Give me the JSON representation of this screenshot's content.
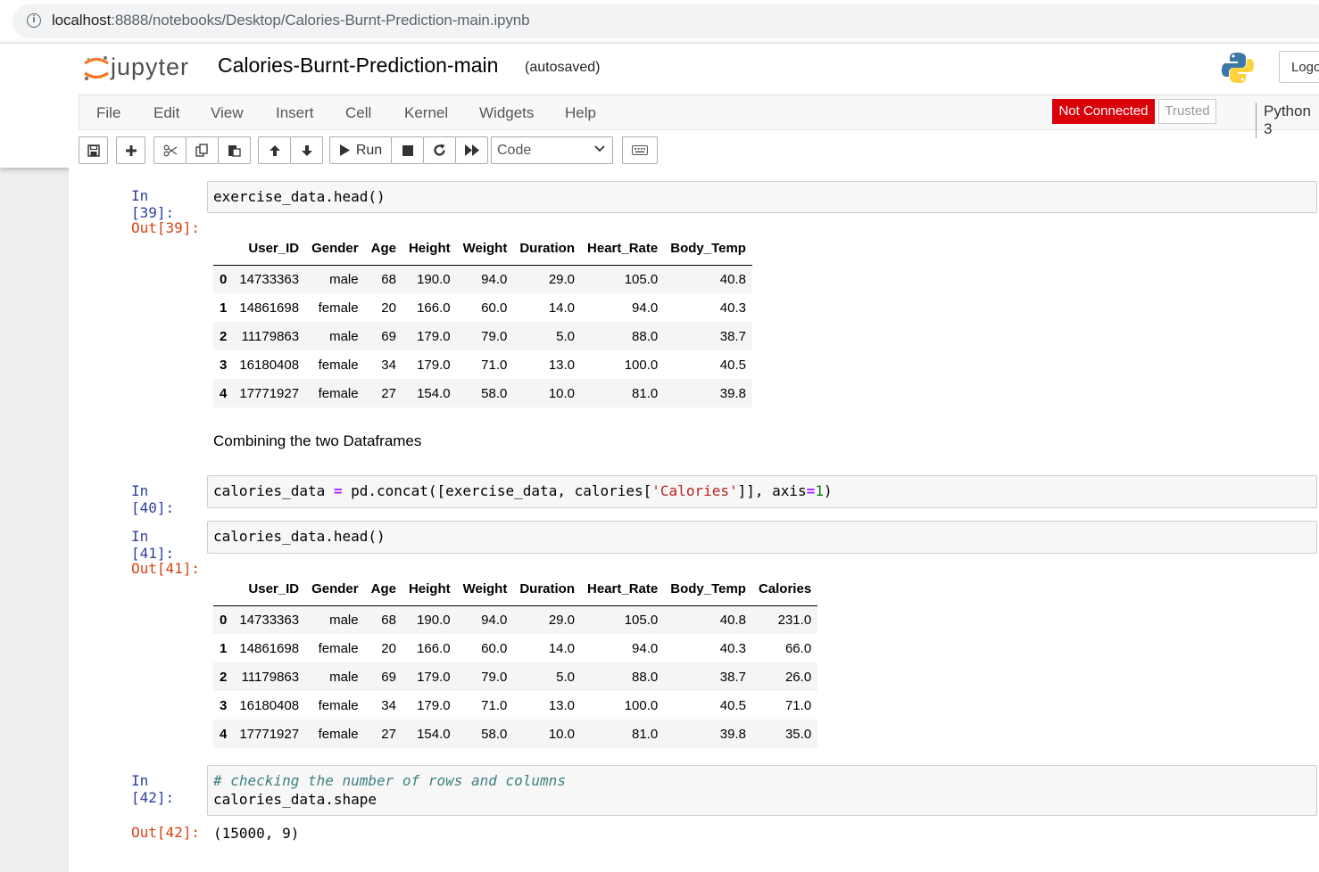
{
  "browser": {
    "url_host": "localhost",
    "url_path": ":8888/notebooks/Desktop/Calories-Burnt-Prediction-main.ipynb"
  },
  "header": {
    "logo_text": "jupyter",
    "notebook_title": "Calories-Burnt-Prediction-main",
    "autosave_status": "(autosaved)",
    "logout_label": "Logout"
  },
  "menu": [
    "File",
    "Edit",
    "View",
    "Insert",
    "Cell",
    "Kernel",
    "Widgets",
    "Help"
  ],
  "status": {
    "connection": "Not Connected",
    "trusted": "Trusted",
    "kernel": "Python 3"
  },
  "toolbar": {
    "run_label": "Run",
    "cell_type": "Code"
  },
  "cells": {
    "c39": {
      "in_prompt": "In [39]:",
      "code": "exercise_data.head()",
      "out_prompt": "Out[39]:",
      "table": {
        "columns": [
          "",
          "User_ID",
          "Gender",
          "Age",
          "Height",
          "Weight",
          "Duration",
          "Heart_Rate",
          "Body_Temp"
        ],
        "rows": [
          [
            "0",
            "14733363",
            "male",
            "68",
            "190.0",
            "94.0",
            "29.0",
            "105.0",
            "40.8"
          ],
          [
            "1",
            "14861698",
            "female",
            "20",
            "166.0",
            "60.0",
            "14.0",
            "94.0",
            "40.3"
          ],
          [
            "2",
            "11179863",
            "male",
            "69",
            "179.0",
            "79.0",
            "5.0",
            "88.0",
            "38.7"
          ],
          [
            "3",
            "16180408",
            "female",
            "34",
            "179.0",
            "71.0",
            "13.0",
            "100.0",
            "40.5"
          ],
          [
            "4",
            "17771927",
            "female",
            "27",
            "154.0",
            "58.0",
            "10.0",
            "81.0",
            "39.8"
          ]
        ]
      }
    },
    "markdown": "Combining the two Dataframes",
    "c40": {
      "in_prompt": "In [40]:",
      "code_parts": [
        "calories_data ",
        "=",
        " pd.concat([exercise_data, calories[",
        "'Calories'",
        "]], axis",
        "=",
        "1",
        ")"
      ]
    },
    "c41": {
      "in_prompt": "In [41]:",
      "code": "calories_data.head()",
      "out_prompt": "Out[41]:",
      "table": {
        "columns": [
          "",
          "User_ID",
          "Gender",
          "Age",
          "Height",
          "Weight",
          "Duration",
          "Heart_Rate",
          "Body_Temp",
          "Calories"
        ],
        "rows": [
          [
            "0",
            "14733363",
            "male",
            "68",
            "190.0",
            "94.0",
            "29.0",
            "105.0",
            "40.8",
            "231.0"
          ],
          [
            "1",
            "14861698",
            "female",
            "20",
            "166.0",
            "60.0",
            "14.0",
            "94.0",
            "40.3",
            "66.0"
          ],
          [
            "2",
            "11179863",
            "male",
            "69",
            "179.0",
            "79.0",
            "5.0",
            "88.0",
            "38.7",
            "26.0"
          ],
          [
            "3",
            "16180408",
            "female",
            "34",
            "179.0",
            "71.0",
            "13.0",
            "100.0",
            "40.5",
            "71.0"
          ],
          [
            "4",
            "17771927",
            "female",
            "27",
            "154.0",
            "58.0",
            "10.0",
            "81.0",
            "39.8",
            "35.0"
          ]
        ]
      }
    },
    "c42": {
      "in_prompt": "In [42]:",
      "comment": "# checking the number of rows and columns",
      "code": "calories_data.shape",
      "out_prompt": "Out[42]:",
      "output": "(15000, 9)"
    }
  },
  "colors": {
    "in_prompt": "#303f9f",
    "out_prompt": "#d84315",
    "not_connected": "#d9000a"
  }
}
